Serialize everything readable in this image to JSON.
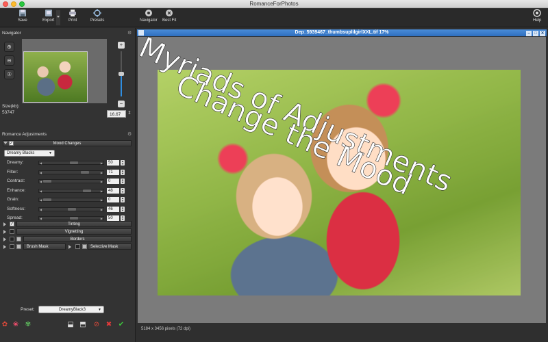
{
  "app": {
    "title": "RomanceForPhotos"
  },
  "toolbar": {
    "save": "Save",
    "export": "Export",
    "print": "Print",
    "presets": "Presets",
    "navigator": "Navigator",
    "best_fit": "Best Fit",
    "help": "Help"
  },
  "navigator": {
    "title": "Navigator",
    "size_label": "Size(kb):",
    "size_value": "53747",
    "zoom_value": "16.67",
    "zoom_level": 0.17
  },
  "adjustments": {
    "title": "Romance Adjustments",
    "groups": {
      "mood": "Mood Changes",
      "tinting": "Tinting",
      "vignetting": "Vignetting",
      "borders": "Borders",
      "brush_mask": "Brush Mask",
      "selective_mask": "Selective Mask"
    },
    "mood_preset": "Dreamy Blacks",
    "sliders": [
      {
        "label": "Dreamy:",
        "value": "50",
        "level": 0.5
      },
      {
        "label": "Filter:",
        "value": "71",
        "level": 0.71
      },
      {
        "label": "Contrast:",
        "value": "0",
        "level": 0.0
      },
      {
        "label": "Enhance:",
        "value": "48",
        "level": 0.74
      },
      {
        "label": "Grain:",
        "value": "0",
        "level": 0.0
      },
      {
        "label": "Softness:",
        "value": "46",
        "level": 0.46
      },
      {
        "label": "Spread:",
        "value": "50",
        "level": 0.5
      }
    ]
  },
  "preset": {
    "label": "Preset:",
    "value": "DreamyBlack3"
  },
  "document": {
    "title": "Dep_5939467_thumbsuplilgirlXXL.tif 17%",
    "status": "5184 x 3456 pixels (72 dpi)"
  },
  "overlay": {
    "line1": "Myriads of Adjustments",
    "line2": "Change the Mood"
  },
  "colors": {
    "accent": "#2f8de0",
    "title_blue": "#3a7fcc"
  }
}
